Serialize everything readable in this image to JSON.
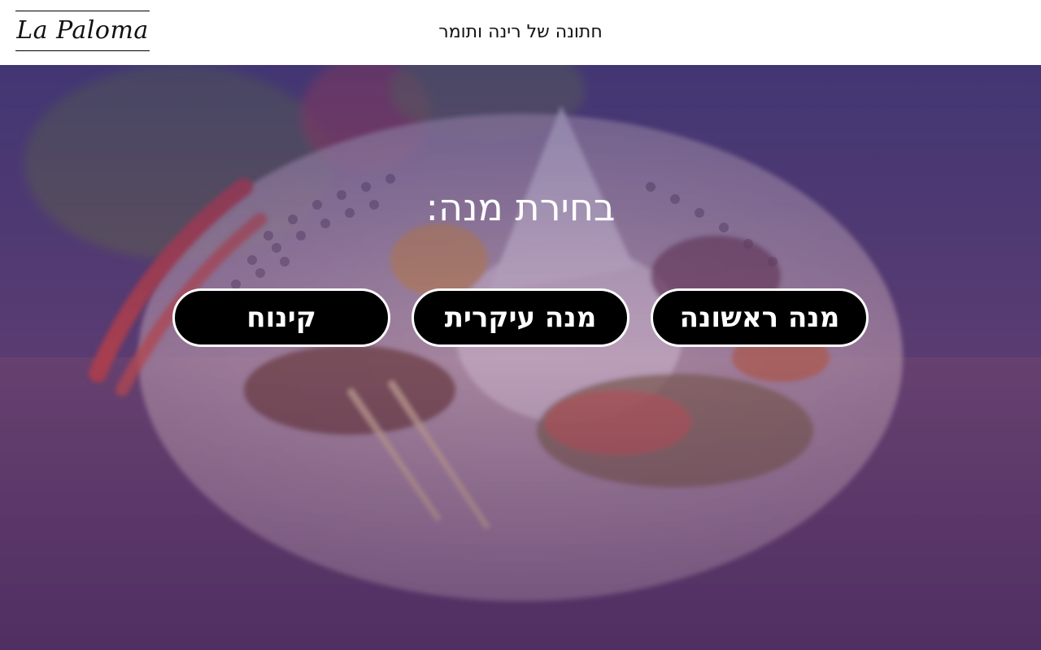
{
  "header": {
    "logo_text": "La Paloma",
    "event_title": "חתונה של רינה ותומר"
  },
  "main": {
    "heading": "בחירת מנה:",
    "buttons": [
      {
        "label": "מנה ראשונה"
      },
      {
        "label": "מנה עיקרית"
      },
      {
        "label": "קינוח"
      }
    ]
  },
  "colors": {
    "header_bg": "#ffffff",
    "button_bg": "#000000",
    "button_border": "#ffffff",
    "heading_text": "#ffffff",
    "overlay_tint": "#4b3a7a"
  }
}
